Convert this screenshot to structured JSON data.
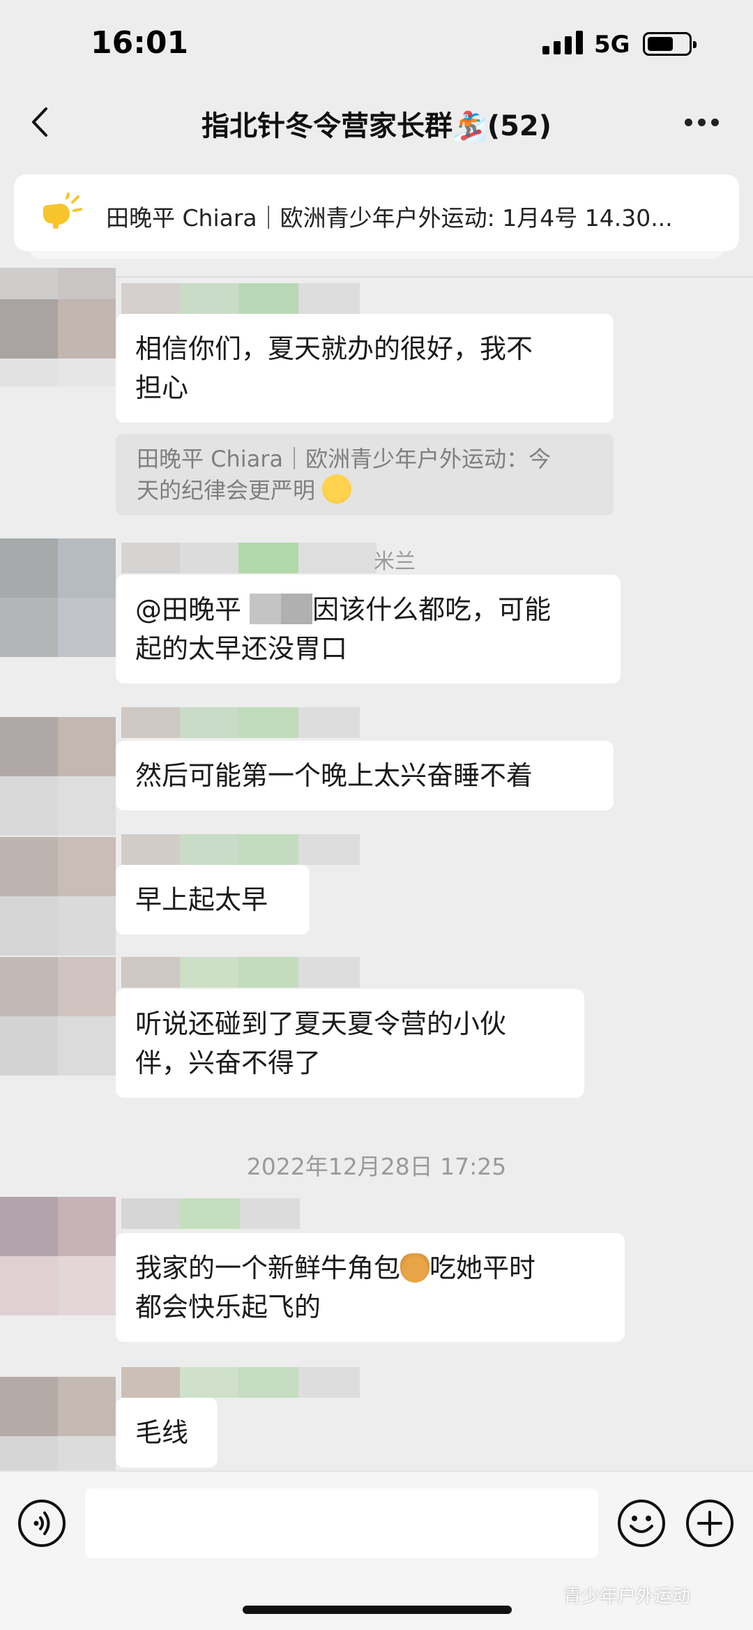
{
  "status_bar": {
    "time": "16:01",
    "network": "5G"
  },
  "header": {
    "title": "指北针冬令营家长群🏂(52)"
  },
  "pinned_notice": {
    "text": "田晚平 Chiara｜欧洲青少年户外运动: 1月4号 14.30..."
  },
  "messages": [
    {
      "text_line1": "相信你们，夏天就办的很好，我不",
      "text_line2": "担心",
      "quote_line1": "田晚平 Chiara｜欧洲青少年户外运动：今",
      "quote_line2": "天的纪律会更严明"
    },
    {
      "sender_suffix": "米兰",
      "text_line1_a": "@田晚平",
      "text_line1_b": "因该什么都吃，可能",
      "text_line2": "起的太早还没胃口"
    },
    {
      "text": "然后可能第一个晚上太兴奋睡不着"
    },
    {
      "text": "早上起太早"
    },
    {
      "text_line1": "听说还碰到了夏天夏令营的小伙",
      "text_line2": "伴，兴奋不得了"
    },
    {
      "text_line1_a": "我家的一个新鲜牛角包",
      "text_line1_b": "吃她平时",
      "text_line2": "都会快乐起飞的"
    },
    {
      "text": "毛线"
    }
  ],
  "timestamp": "2022年12月28日 17:25",
  "input": {
    "value": ""
  },
  "watermark": "青少年户外运动",
  "colors": {
    "background": "#ededed",
    "bubble": "#ffffff",
    "quote": "#e3e3e3"
  }
}
